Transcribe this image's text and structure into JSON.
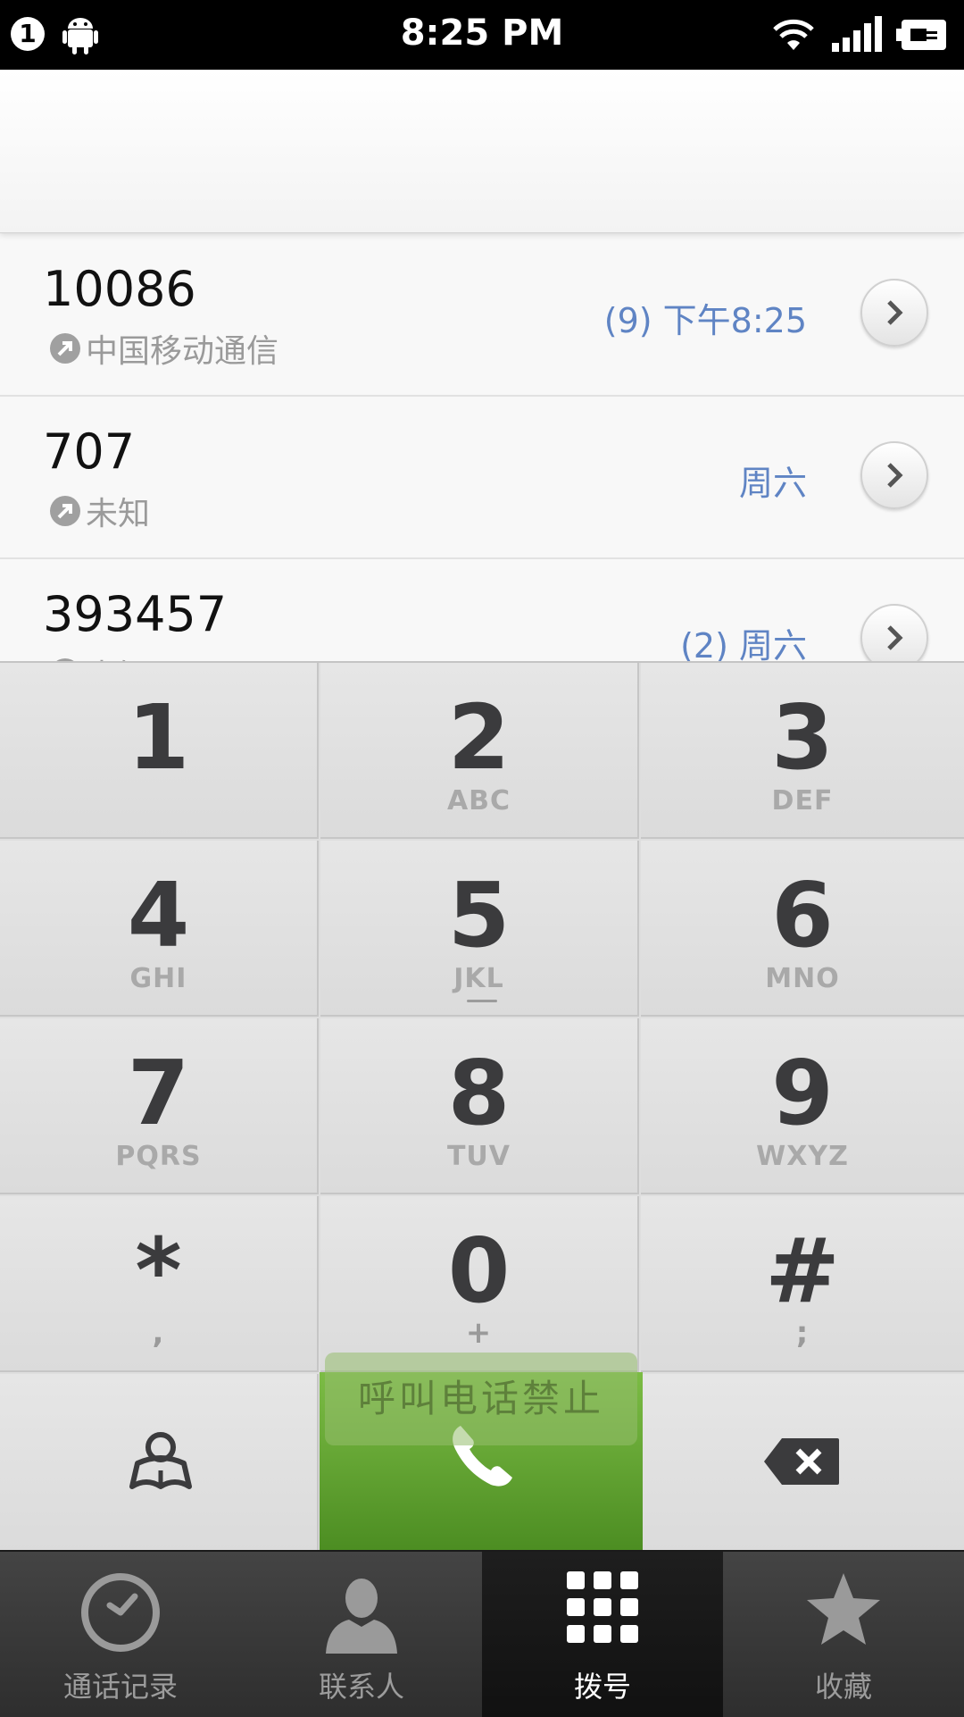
{
  "status_bar": {
    "notification_count": "1",
    "time": "8:25 PM",
    "icons": [
      "android-icon",
      "wifi-icon",
      "signal-icon",
      "battery-charging-icon"
    ]
  },
  "call_log": [
    {
      "number": "10086",
      "location": "中国移动通信",
      "count_time": "(9) 下午8:25"
    },
    {
      "number": "707",
      "location": "未知",
      "count_time": "周六"
    },
    {
      "number": "393457",
      "location": "未知",
      "count_time": "(2) 周六"
    }
  ],
  "keypad": {
    "keys": [
      {
        "digit": "1",
        "letters": ""
      },
      {
        "digit": "2",
        "letters": "ABC"
      },
      {
        "digit": "3",
        "letters": "DEF"
      },
      {
        "digit": "4",
        "letters": "GHI"
      },
      {
        "digit": "5",
        "letters": "JKL"
      },
      {
        "digit": "6",
        "letters": "MNO"
      },
      {
        "digit": "7",
        "letters": "PQRS"
      },
      {
        "digit": "8",
        "letters": "TUV"
      },
      {
        "digit": "9",
        "letters": "WXYZ"
      },
      {
        "digit": "*",
        "letters": ","
      },
      {
        "digit": "0",
        "letters": "+"
      },
      {
        "digit": "#",
        "letters": ";"
      }
    ],
    "toast": "呼叫电话禁止"
  },
  "tabs": [
    {
      "label": "通话记录",
      "icon": "clock-icon"
    },
    {
      "label": "联系人",
      "icon": "person-icon"
    },
    {
      "label": "拨号",
      "icon": "dialpad-icon",
      "active": true
    },
    {
      "label": "收藏",
      "icon": "star-icon"
    }
  ],
  "colors": {
    "accent_blue": "#5f84c4",
    "call_green": "#5a9d2e",
    "tabbar_bg": "#333333"
  }
}
